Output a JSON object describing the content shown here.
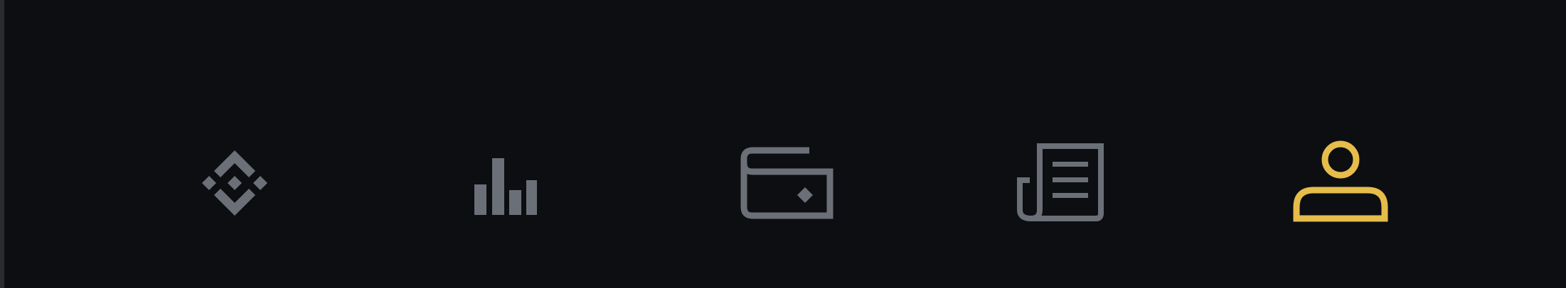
{
  "tab_bar": {
    "active_index": 4,
    "colors": {
      "background": "#0d0e11",
      "inactive_icon": "#6b7078",
      "active_icon": "#e6bd4b"
    },
    "tabs": [
      {
        "icon": "binance-logo-icon",
        "active": false
      },
      {
        "icon": "bar-chart-icon",
        "active": false
      },
      {
        "icon": "wallet-icon",
        "active": false
      },
      {
        "icon": "newspaper-icon",
        "active": false
      },
      {
        "icon": "user-profile-icon",
        "active": true
      }
    ]
  }
}
